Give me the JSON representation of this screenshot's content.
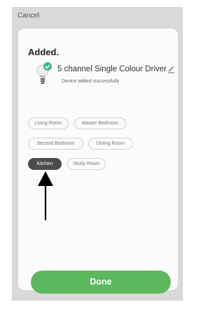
{
  "header": {
    "cancel_label": "Cancel"
  },
  "sheet": {
    "title": "Added.",
    "device": {
      "name": "5 channel Single Colour Driver",
      "status": "Device added successfully",
      "icon": "bulb-icon",
      "badge_icon": "check-icon",
      "badge_color": "#3bb58a"
    },
    "rooms": [
      {
        "label": "Living Room",
        "selected": false
      },
      {
        "label": "Master Bedroom",
        "selected": false
      },
      {
        "label": "Second Bedroom",
        "selected": false
      },
      {
        "label": "Dining Room",
        "selected": false
      },
      {
        "label": "Kitchen",
        "selected": true
      },
      {
        "label": "Study Room",
        "selected": false
      }
    ],
    "done_label": "Done",
    "done_color": "#5cb85c"
  }
}
